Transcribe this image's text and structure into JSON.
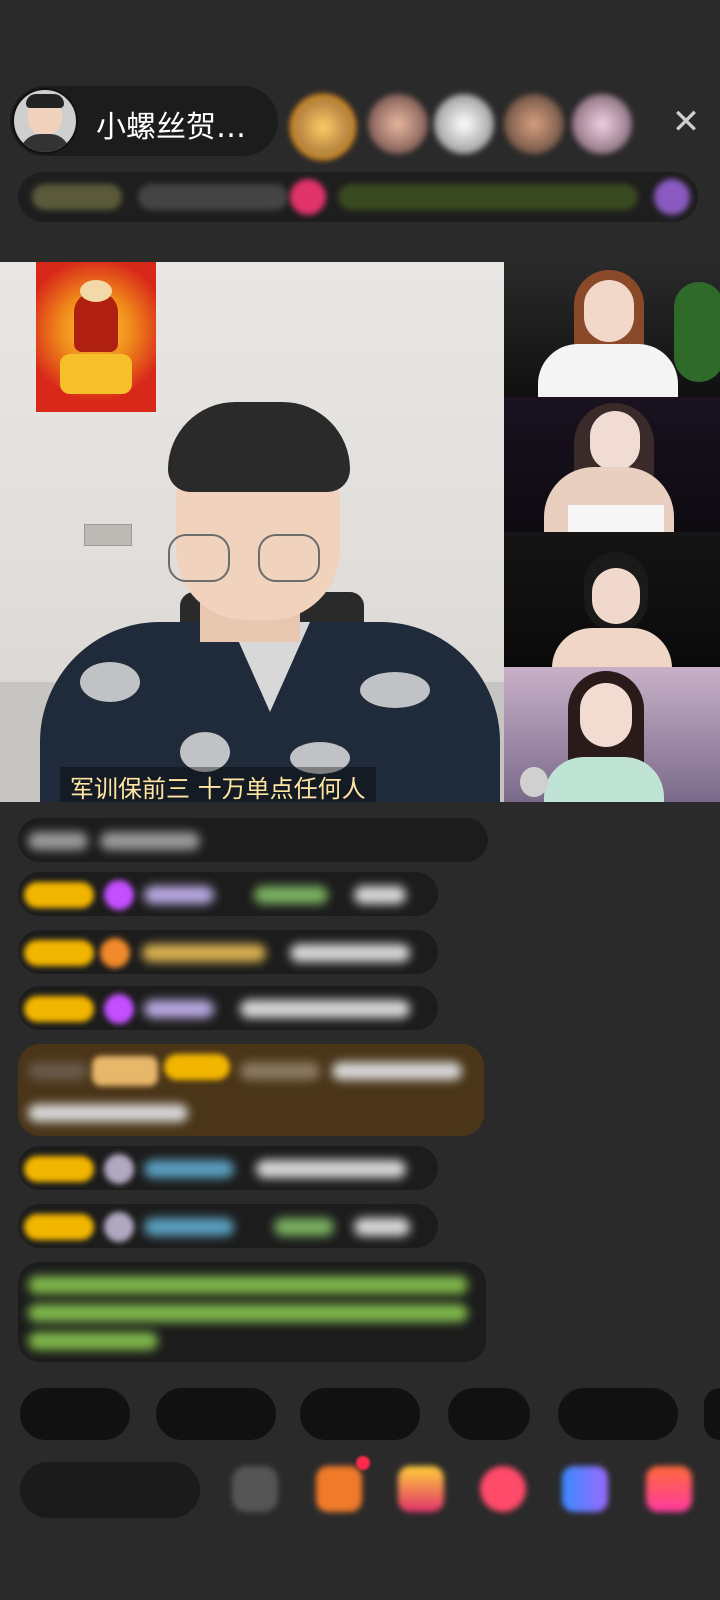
{
  "header": {
    "host_name": "小螺丝贺…",
    "close_icon": "close-icon"
  },
  "video": {
    "caption": "军训保前三  十万单点任何人"
  },
  "chat": {
    "messages_count_visible": 9
  },
  "quick_replies": [
    "",
    "",
    "",
    "",
    ""
  ],
  "bottom_bar": {
    "say_placeholder": "",
    "icons": [
      "emoji-icon",
      "gift-box-icon",
      "treasure-icon",
      "heart-icon",
      "game-icon",
      "more-gifts-icon"
    ]
  },
  "colors": {
    "background": "#2a2a2a",
    "badge": "#f2b600",
    "purple_gem": "#c34fff"
  }
}
